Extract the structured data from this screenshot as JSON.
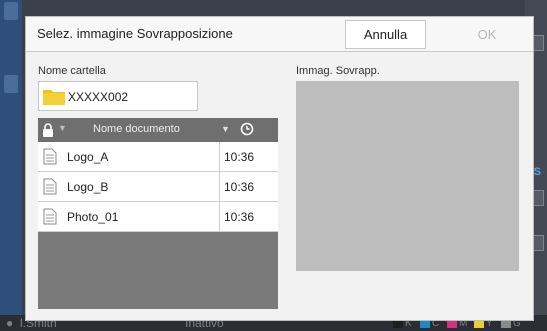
{
  "modal": {
    "title": "Selez. immagine Sovrapposizione",
    "cancel_label": "Annulla",
    "ok_label": "OK"
  },
  "folder": {
    "label": "Nome cartella",
    "name": "XXXXX002"
  },
  "list": {
    "column_name": "Nome documento",
    "rows": [
      {
        "name": "Logo_A",
        "time": "10:36"
      },
      {
        "name": "Logo_B",
        "time": "10:36"
      },
      {
        "name": "Photo_01",
        "time": "10:36"
      }
    ]
  },
  "preview": {
    "label": "Immag. Sovrapp."
  },
  "status_bar": {
    "user": "l.Smith",
    "status": "Inattivo",
    "ink_labels": [
      "K",
      "C",
      "M",
      "Y",
      "G"
    ],
    "ink_colors": [
      "#1f1f1f",
      "#1e88c8",
      "#d62f87",
      "#e8d02a",
      "#8a8a8a"
    ]
  },
  "colors": {
    "folder_yellow": "#f2c21b",
    "modal_bg": "#f2f2f2",
    "list_bg": "#7a7a7a",
    "preview_bg": "#bdbdbd"
  }
}
